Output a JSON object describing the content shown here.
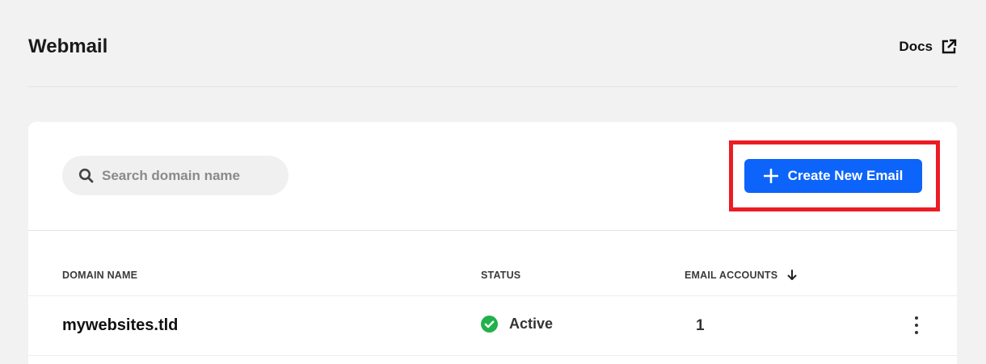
{
  "header": {
    "title": "Webmail",
    "docs_label": "Docs"
  },
  "toolbar": {
    "search_placeholder": "Search domain name",
    "create_label": "Create New Email"
  },
  "table": {
    "columns": [
      "DOMAIN NAME",
      "STATUS",
      "EMAIL ACCOUNTS"
    ],
    "rows": [
      {
        "domain": "mywebsites.tld",
        "status": "Active",
        "email_accounts": "1"
      }
    ]
  },
  "colors": {
    "accent": "#0d64fa",
    "highlight": "#ec1c24",
    "status_active": "#22b14c",
    "background": "#f2f2f2"
  },
  "icons": {
    "search": "search-icon",
    "external": "external-link-icon",
    "plus": "plus-icon",
    "sort": "arrow-down-icon",
    "status": "check-circle-icon",
    "menu": "more-vertical-icon"
  }
}
